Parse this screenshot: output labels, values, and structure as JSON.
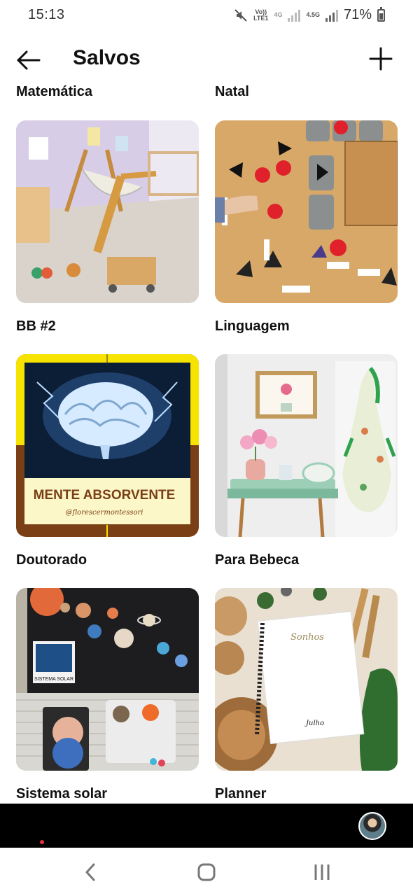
{
  "status": {
    "time": "15:13",
    "network_top": "Vo))",
    "network_bottom": "LTE1",
    "net_4g": "4G",
    "net_45g": "4.5G",
    "battery": "71%"
  },
  "header": {
    "title": "Salvos",
    "back_icon": "arrow-left-icon",
    "add_icon": "plus-icon"
  },
  "boards_top_labels": [
    "Matemática",
    "Natal"
  ],
  "boards": [
    {
      "label": "BB #2",
      "image": "playroom-climbing-triangle"
    },
    {
      "label": "Linguagem",
      "image": "montessori-shapes-table"
    },
    {
      "label": "Doutorado",
      "image": "mente-absorvente-brain",
      "image_caption": "MENTE ABSORVENTE",
      "image_subcaption": "@florescermontessori"
    },
    {
      "label": "Para Bebeca",
      "image": "shelf-flowers-apron"
    },
    {
      "label": "Sistema solar",
      "image": "solar-system-activity",
      "image_caption": "SISTEMA SOLAR"
    },
    {
      "label": "Planner",
      "image": "planner-notebook",
      "image_caption": "Sonhos",
      "image_subcaption": "Julho"
    }
  ],
  "colors": {
    "background": "#ffffff",
    "nav_bar": "#000000",
    "notification_dot": "#e5313d"
  },
  "system_nav": [
    "back-chevron-icon",
    "home-circle-icon",
    "recents-bars-icon"
  ]
}
